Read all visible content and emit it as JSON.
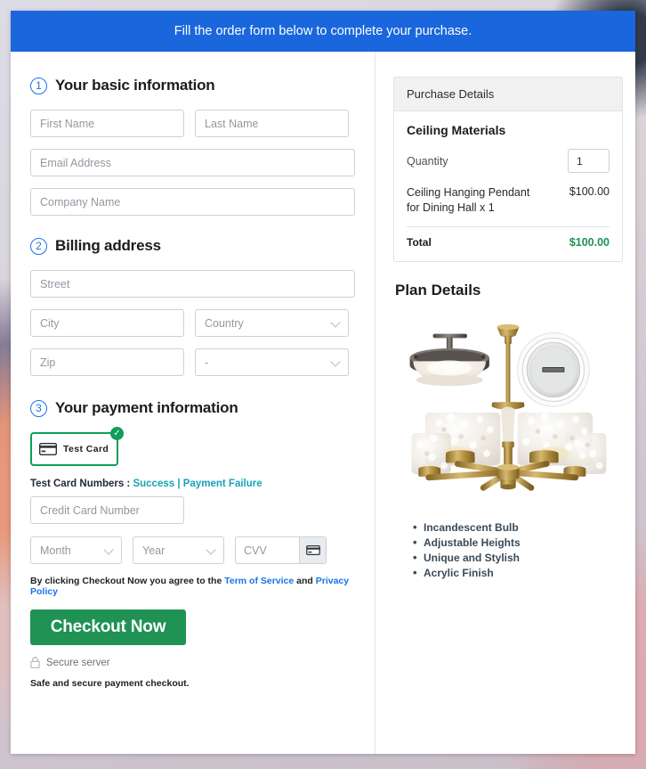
{
  "banner": {
    "text": "Fill the order form below to complete your purchase."
  },
  "colors": {
    "banner_blue": "#1a66dd",
    "accent_blue": "#1a73e8",
    "link_teal": "#17a2b8",
    "success_green": "#0f9d58",
    "checkout_green": "#1f9254"
  },
  "sections": {
    "basic": {
      "step": "1",
      "title": "Your basic information",
      "fields": {
        "first_name": "First Name",
        "last_name": "Last Name",
        "email": "Email Address",
        "company": "Company Name"
      }
    },
    "billing": {
      "step": "2",
      "title": "Billing address",
      "fields": {
        "street": "Street",
        "city": "City",
        "country": "Country",
        "zip": "Zip",
        "state": "-"
      }
    },
    "payment": {
      "step": "3",
      "title": "Your payment information",
      "test_card_label": "Test Card",
      "test_card_numbers_label": "Test Card Numbers :",
      "link_success": "Success",
      "link_separator": "|",
      "link_failure": "Payment Failure",
      "fields": {
        "credit_card_number": "Credit Card Number",
        "month": "Month",
        "year": "Year",
        "cvv": "CVV"
      },
      "terms_prefix": "By clicking Checkout Now you agree to the",
      "terms_link_1": "Term of Service",
      "terms_and": "and",
      "terms_link_2": "Privacy Policy",
      "checkout_button": "Checkout Now",
      "secure_server": "Secure server",
      "safe_note": "Safe and secure payment checkout."
    }
  },
  "purchase_details": {
    "header": "Purchase Details",
    "product_group": "Ceiling Materials",
    "quantity_label": "Quantity",
    "quantity_value": "1",
    "line_item_name": "Ceiling Hanging Pendant for Dining Hall x 1",
    "line_item_price": "$100.00",
    "total_label": "Total",
    "total_value": "$100.00"
  },
  "plan_details": {
    "title": "Plan Details",
    "features": [
      "Incandescent Bulb",
      "Adjustable Heights",
      "Unique and Stylish",
      "Acrylic Finish"
    ]
  }
}
